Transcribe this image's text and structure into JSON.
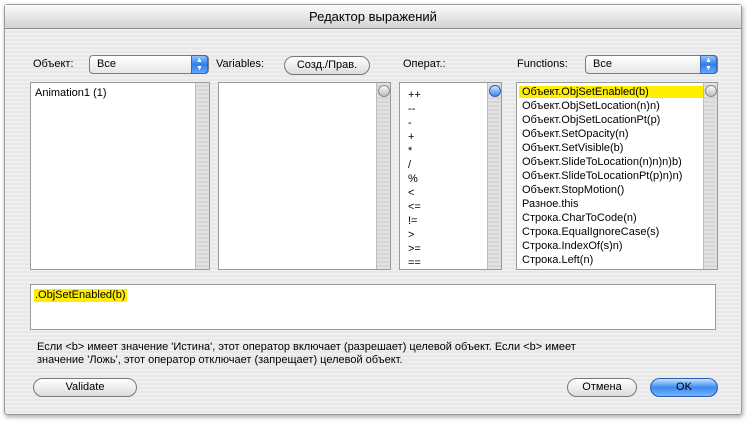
{
  "window": {
    "title": "Редактор выражений"
  },
  "object_label": "Объект:",
  "object_popup": "Все",
  "variables_label": "Variables:",
  "create_edit_button": "Созд./Прав.",
  "operators_label": "Операт.:",
  "functions_label": "Functions:",
  "functions_popup": "Все",
  "objects_list": [
    "Animation1 (1)"
  ],
  "operators_list": [
    "++",
    "--",
    "-",
    "+",
    "*",
    "/",
    "%",
    "<",
    "<=",
    "!=",
    ">",
    ">=",
    "=="
  ],
  "functions_list": [
    "Объект.ObjSetEnabled(b)",
    "Объект.ObjSetLocation(n)n)",
    "Объект.ObjSetLocationPt(p)",
    "Объект.SetOpacity(n)",
    "Объект.SetVisible(b)",
    "Объект.SlideToLocation(n)n)n)b)",
    "Объект.SlideToLocationPt(p)n)n)",
    "Объект.StopMotion()",
    "Разное.this",
    "Строка.CharToCode(n)",
    "Строка.EqualIgnoreCase(s)",
    "Строка.IndexOf(s)n)",
    "Строка.Left(n)"
  ],
  "selected_function_index": 0,
  "expression": ".ObjSetEnabled(b)",
  "description_line1": "Если <b> имеет значение 'Истина', этот оператор включает (разрешает) целевой объект. Если <b> имеет",
  "description_line2": "значение 'Ложь', этот оператор отключает (запрещает) целевой объект.",
  "buttons": {
    "validate": "Validate",
    "cancel": "Отмена",
    "ok": "OK"
  },
  "colors": {
    "selection": "#ffee00",
    "accent": "#3a8af0"
  }
}
